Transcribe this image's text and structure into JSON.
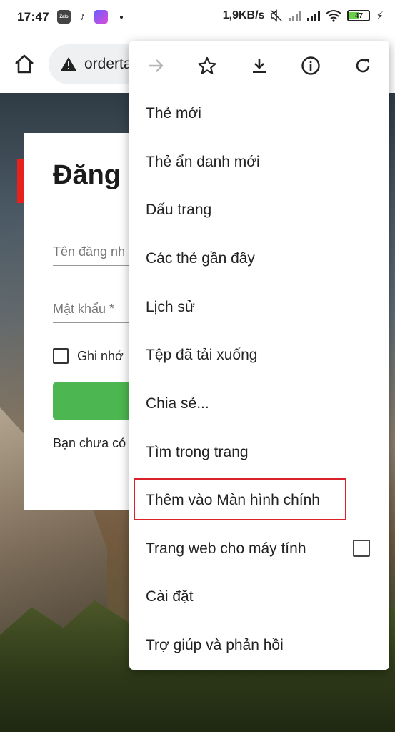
{
  "status": {
    "time": "17:47",
    "speed": "1,9KB/s",
    "battery": "47"
  },
  "browser": {
    "url": "orderta"
  },
  "page": {
    "title": "Đăng n",
    "username_placeholder": "Tên đăng nh",
    "password_placeholder": "Mật khẩu *",
    "remember_label": "Ghi nhớ",
    "signup_text": "Bạn chưa có"
  },
  "menu": {
    "items": [
      {
        "label": "Thẻ mới"
      },
      {
        "label": "Thẻ ẩn danh mới"
      },
      {
        "label": "Dấu trang"
      },
      {
        "label": "Các thẻ gần đây"
      },
      {
        "label": "Lịch sử"
      },
      {
        "label": "Tệp đã tải xuống"
      },
      {
        "label": "Chia sẻ..."
      },
      {
        "label": "Tìm trong trang"
      },
      {
        "label": "Thêm vào Màn hình chính"
      },
      {
        "label": "Trang web cho máy tính"
      },
      {
        "label": "Cài đặt"
      },
      {
        "label": "Trợ giúp và phản hồi"
      }
    ]
  },
  "colors": {
    "highlight": "#d8232a",
    "login_button": "#4cb650",
    "accent": "#e8211c"
  }
}
